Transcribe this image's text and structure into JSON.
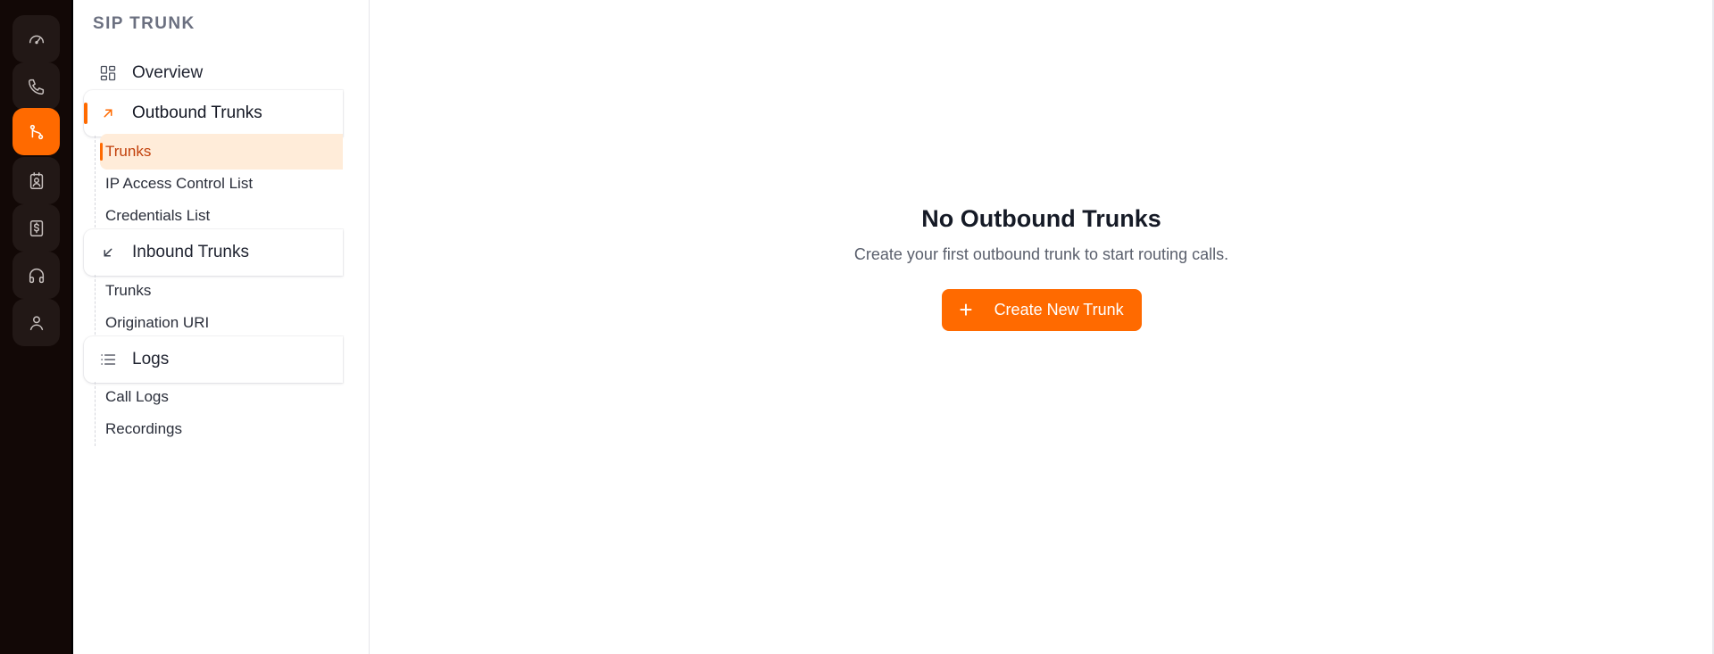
{
  "rail": {
    "items": [
      {
        "icon": "gauge-icon",
        "active": false
      },
      {
        "icon": "phone-icon",
        "active": false
      },
      {
        "icon": "git-branch-icon",
        "active": true
      },
      {
        "icon": "contact-badge-icon",
        "active": false
      },
      {
        "icon": "billing-dollar-icon",
        "active": false
      },
      {
        "icon": "headset-icon",
        "active": false
      },
      {
        "icon": "user-icon",
        "active": false
      }
    ]
  },
  "nav": {
    "title": "SIP TRUNK",
    "overview": {
      "label": "Overview",
      "icon": "grid-icon"
    },
    "outbound": {
      "label": "Outbound Trunks",
      "icon": "arrow-up-right-icon",
      "items": [
        "Trunks",
        "IP Access Control List",
        "Credentials List"
      ]
    },
    "inbound": {
      "label": "Inbound Trunks",
      "icon": "arrow-down-left-icon",
      "items": [
        "Trunks",
        "Origination URI"
      ]
    },
    "logs": {
      "label": "Logs",
      "icon": "list-icon",
      "items": [
        "Call Logs",
        "Recordings"
      ]
    }
  },
  "main": {
    "empty_title": "No Outbound Trunks",
    "empty_subtitle": "Create your first outbound trunk to start routing calls.",
    "create_button": "Create New Trunk",
    "create_icon": "+"
  },
  "colors": {
    "accent": "#ff6a00",
    "rail_bg": "#120806",
    "selected_bg": "#ffecd9",
    "selected_text": "#c2410c"
  }
}
